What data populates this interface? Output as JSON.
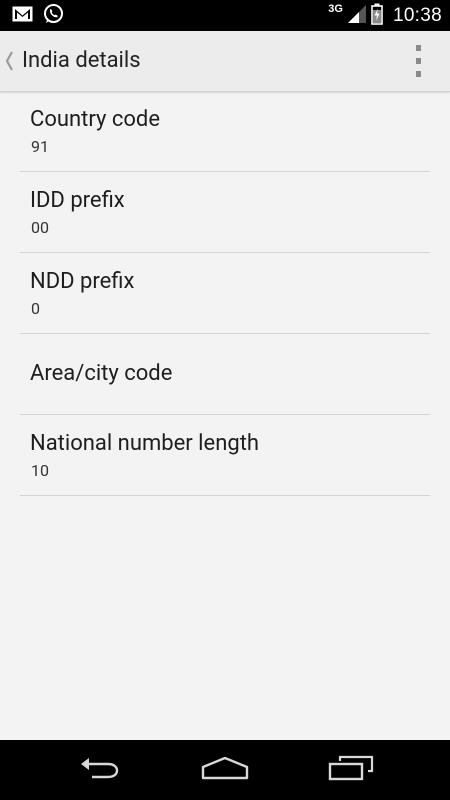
{
  "status_bar": {
    "time": "10:38",
    "network_type": "3G",
    "icons": [
      "gmail-icon",
      "whatsapp-icon",
      "signal-icon",
      "battery-icon"
    ]
  },
  "action_bar": {
    "title": "India details"
  },
  "details": [
    {
      "label": "Country code",
      "value": "91"
    },
    {
      "label": "IDD prefix",
      "value": "00"
    },
    {
      "label": "NDD prefix",
      "value": "0"
    },
    {
      "label": "Area/city code",
      "value": ""
    },
    {
      "label": "National number length",
      "value": "10"
    }
  ],
  "nav_bar": {
    "buttons": [
      "back-icon",
      "home-icon",
      "recents-icon"
    ]
  }
}
